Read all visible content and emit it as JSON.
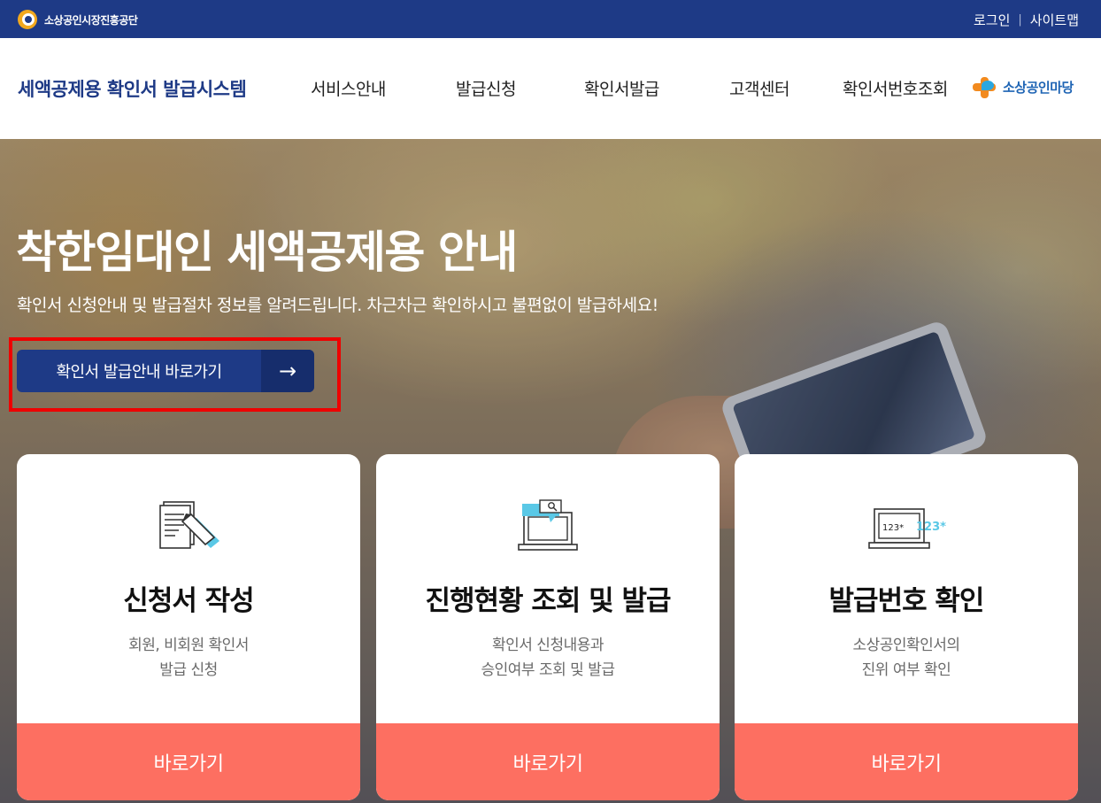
{
  "topbar": {
    "org_name": "소상공인시장진흥공단",
    "login": "로그인",
    "separator": "|",
    "sitemap": "사이트맵"
  },
  "header": {
    "site_title": "세액공제용 확인서 발급시스템",
    "nav": [
      "서비스안내",
      "발급신청",
      "확인서발급",
      "고객센터",
      "확인서번호조회"
    ],
    "brand": "소상공인마당"
  },
  "hero": {
    "title": "착한임대인 세액공제용 안내",
    "subtitle": "확인서 신청안내 및 발급절차 정보를 알려드립니다. 차근차근 확인하시고 불편없이 발급하세요!",
    "guide_button": "확인서 발급안내 바로가기",
    "guide_arrow": "→"
  },
  "cards": [
    {
      "icon": "document-pencil-icon",
      "title": "신청서 작성",
      "desc": [
        "회원, 비회원 확인서",
        "발급 신청"
      ],
      "button": "바로가기"
    },
    {
      "icon": "laptop-search-icon",
      "title": "진행현황 조회 및 발급",
      "desc": [
        "확인서 신청내용과",
        "승인여부 조회 및 발급"
      ],
      "button": "바로가기"
    },
    {
      "icon": "laptop-number-icon",
      "title": "발급번호 확인",
      "desc": [
        "소상공인확인서의",
        "진위 여부 확인"
      ],
      "button": "바로가기",
      "icon_text_dark": "123*",
      "icon_text_light": "123*"
    }
  ],
  "colors": {
    "navy": "#1e3a86",
    "coral": "#fd6f61",
    "highlight_box": "#ee0000",
    "icon_accent": "#5ac8e6"
  }
}
